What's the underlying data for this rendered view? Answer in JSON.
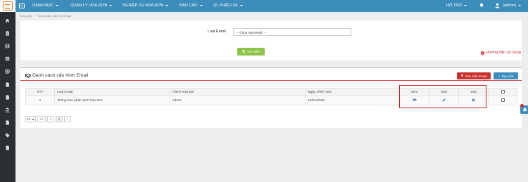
{
  "nav": {
    "items": [
      {
        "label": "DANH MỤC"
      },
      {
        "label": "QUẢN LÝ HÓA ĐƠN"
      },
      {
        "label": "NGHIỆP VỤ HÓA ĐƠN"
      },
      {
        "label": "BÁO CÁO"
      },
      {
        "label": "QL PHIẾU XK"
      }
    ],
    "support_label": "HỖ TRỢ",
    "user_label": "(admin)"
  },
  "breadcrumb": {
    "home": "Trang chủ",
    "current": "Danh sách cấu hình Email"
  },
  "filter": {
    "email_type_label": "Loại Email",
    "email_type_value": "-- Chọn loại email --",
    "search_label": "Tìm kiếm",
    "help_label": "Hướng dẫn sử dụng"
  },
  "list": {
    "title": "Danh sách cấu hình Email",
    "delete_template_label": "Xóa mẫu Email",
    "create_label": "Tạo mới",
    "columns": [
      "STT",
      "Loại Email",
      "Chỉnh sửa bởi",
      "Ngày chỉnh sửa",
      "Xem",
      "Sửa",
      "Xóa"
    ],
    "rows": [
      {
        "stt": "1",
        "type": "Thông báo phát hành hóa đơn",
        "edited_by": "admin",
        "edited_date": "10/01/2025"
      }
    ]
  },
  "pager": {
    "page_size": "10",
    "first": "<<",
    "prev": "<",
    "current": "1",
    "next": ">"
  },
  "colors": {
    "topbar": "#3c8dbc",
    "sidebar": "#2b2f33",
    "success": "#8dc34a",
    "danger": "#c9302c",
    "highlight": "#d42020"
  },
  "icons": {
    "sidebar": [
      "home-icon",
      "document-icon",
      "save-icon",
      "refresh-icon",
      "support-icon",
      "file-icon",
      "file-icon",
      "bank-icon",
      "file-icon",
      "tag-icon",
      "file-icon"
    ]
  }
}
